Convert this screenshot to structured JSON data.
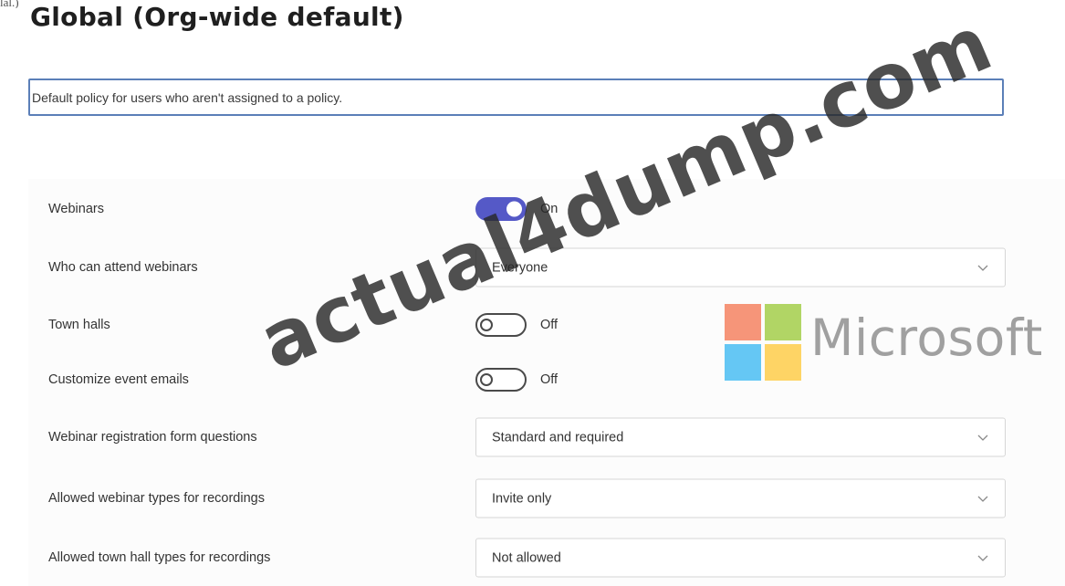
{
  "top_fragment": "lal.)",
  "page_title": "Global (Org-wide default)",
  "description": {
    "value": "Default policy for users who aren't assigned to a policy."
  },
  "settings": [
    {
      "key": "webinars",
      "label": "Webinars",
      "control": "toggle",
      "state": "on",
      "state_label": "On"
    },
    {
      "key": "who-can-attend",
      "label": "Who can attend webinars",
      "control": "dropdown",
      "value": "Everyone"
    },
    {
      "key": "town-halls",
      "label": "Town halls",
      "control": "toggle",
      "state": "off",
      "state_label": "Off"
    },
    {
      "key": "customize-emails",
      "label": "Customize event emails",
      "control": "toggle",
      "state": "off",
      "state_label": "Off"
    },
    {
      "key": "registration-form",
      "label": "Webinar registration form questions",
      "control": "dropdown",
      "value": "Standard and required"
    },
    {
      "key": "webinar-recordings",
      "label": "Allowed webinar types for recordings",
      "control": "dropdown",
      "value": "Invite only"
    },
    {
      "key": "townhall-recordings",
      "label": "Allowed town hall types for recordings",
      "control": "dropdown",
      "value": "Not allowed"
    }
  ],
  "overlay": {
    "logo_text": "Microsoft",
    "logo_colors": [
      "#f25022",
      "#7fba00",
      "#00a4ef",
      "#ffb900"
    ],
    "watermark_text": "actual4dump.com"
  },
  "icons": {
    "dropdown": "chevron-down-icon"
  },
  "colors": {
    "toggle_on": "#5559c7",
    "focus_border": "#5b7fb8"
  }
}
